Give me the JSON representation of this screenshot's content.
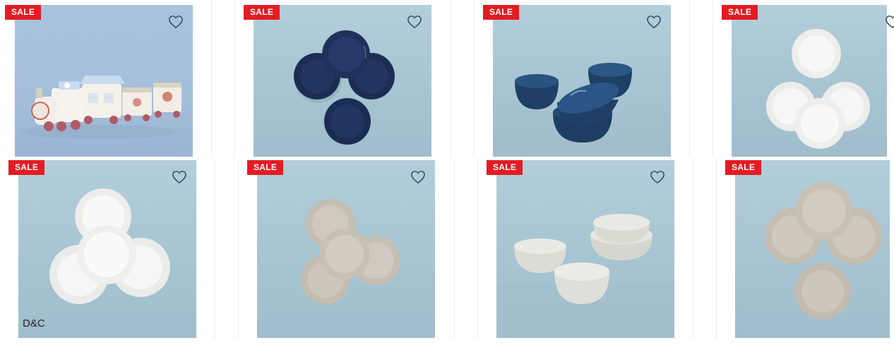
{
  "products": [
    {
      "badge": "SALE",
      "icon": "heart-outline-icon",
      "subject": "ceramic train set"
    },
    {
      "badge": "SALE",
      "icon": "heart-outline-icon",
      "subject": "navy dinner plates"
    },
    {
      "badge": "SALE",
      "icon": "heart-outline-icon",
      "subject": "navy bowls"
    },
    {
      "badge": "SALE",
      "icon": "heart-outline-icon",
      "subject": "white plates"
    },
    {
      "badge": "SALE",
      "icon": "heart-outline-icon",
      "subject": "white dinner plates",
      "brand_mark": "D&C"
    },
    {
      "badge": "SALE",
      "icon": "heart-outline-icon",
      "subject": "grey plates"
    },
    {
      "badge": "SALE",
      "icon": "heart-outline-icon",
      "subject": "cream bowls"
    },
    {
      "badge": "SALE",
      "icon": "heart-outline-icon",
      "subject": "grey dinner plates"
    }
  ],
  "colors": {
    "sale_badge": "#e31c23",
    "heart_stroke": "#2d4b64",
    "photo_background": "#aac6d4",
    "navy_ware": "#1e2f55",
    "white_ware": "#f4f4f2",
    "grey_ware": "#c9c3b8"
  }
}
